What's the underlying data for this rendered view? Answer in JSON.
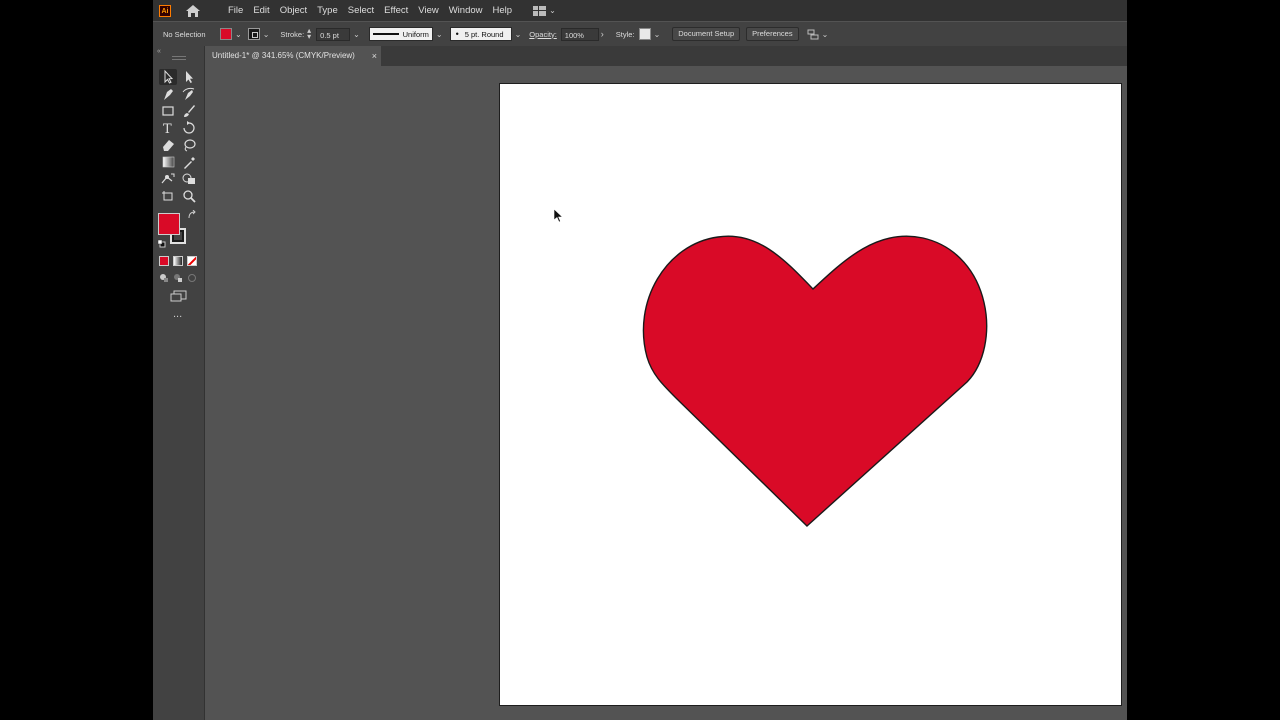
{
  "app": {
    "logo_text": "Ai"
  },
  "menus": [
    "File",
    "Edit",
    "Object",
    "Type",
    "Select",
    "Effect",
    "View",
    "Window",
    "Help"
  ],
  "control_bar": {
    "selection_status": "No Selection",
    "stroke_label": "Stroke:",
    "stroke_weight": "0.5 pt",
    "stroke_profile": "Uniform",
    "brush": "5 pt. Round",
    "opacity_label": "Opacity:",
    "opacity": "100%",
    "style_label": "Style:",
    "document_setup": "Document Setup",
    "preferences": "Preferences"
  },
  "document_tab": {
    "title": "Untitled-1* @ 341.65% (CMYK/Preview)",
    "close": "×"
  },
  "colors": {
    "fill": "#d90a27",
    "stroke": "#000000",
    "heart_fill": "#d90a27",
    "heart_stroke": "#1a1a1a",
    "chrome_dark": "#323232",
    "panel": "#424242",
    "workspace": "#535353"
  },
  "toolbar": {
    "more_tools": "...",
    "tools": [
      "selection-tool",
      "direct-selection-tool",
      "pen-tool",
      "curvature-tool",
      "rectangle-tool",
      "paintbrush-tool",
      "type-tool",
      "rotate-tool",
      "eraser-tool",
      "lasso-tool",
      "gradient-tool",
      "eyedropper-tool",
      "puppet-warp-tool",
      "shape-builder-tool",
      "artboard-tool",
      "zoom-tool"
    ]
  },
  "artwork": {
    "shape": "heart-shape"
  }
}
